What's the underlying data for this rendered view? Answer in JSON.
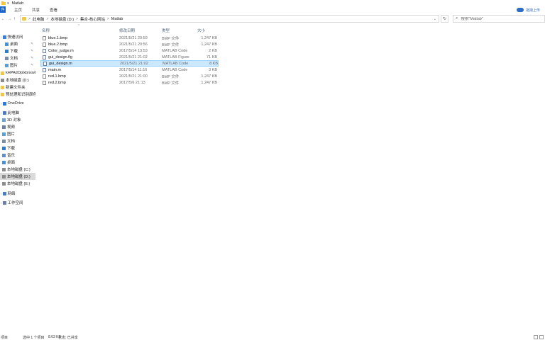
{
  "window": {
    "title": "Matlab",
    "qa_label": "▾"
  },
  "ribbon": {
    "file_tab": "件",
    "tabs": [
      "主页",
      "共享",
      "查看"
    ],
    "upload_label": "拖拽上传"
  },
  "address": {
    "crumbs": [
      "此电脑",
      "本地磁盘 (D:)",
      "集合-核心网站",
      "Matlab"
    ],
    "separator": ">"
  },
  "search": {
    "placeholder": "搜索\"Matlab\""
  },
  "nav": {
    "items": [
      {
        "label": "快速访问",
        "icon": "star-icon",
        "pin": false,
        "expand": "›",
        "selected": false
      },
      {
        "label": "桌面",
        "icon": "desktop-icon",
        "pin": true,
        "selected": false
      },
      {
        "label": "下载",
        "icon": "download-icon",
        "pin": true,
        "selected": false
      },
      {
        "label": "文档",
        "icon": "document-icon",
        "pin": true,
        "selected": false
      },
      {
        "label": "图片",
        "icon": "picture-icon",
        "pin": true,
        "selected": false
      },
      {
        "label": "kHPAdOplxbnxwt",
        "icon": "folder-icon",
        "pin": false,
        "selected": false
      },
      {
        "label": "本地磁盘 (D:)",
        "icon": "drive-icon",
        "pin": false,
        "selected": false
      },
      {
        "label": "新建文件夹",
        "icon": "folder-icon",
        "pin": false,
        "selected": false
      },
      {
        "label": "预处理和识别颜色",
        "icon": "folder-icon",
        "pin": false,
        "selected": false
      },
      {
        "label": "OneDrive",
        "icon": "cloud-icon",
        "pin": false,
        "expand": "›",
        "selected": false
      },
      {
        "label": "此电脑",
        "icon": "computer-icon",
        "pin": false,
        "expand": "›",
        "selected": false
      },
      {
        "label": "3D 对象",
        "icon": "cube-icon",
        "pin": false,
        "selected": false
      },
      {
        "label": "视频",
        "icon": "video-icon",
        "pin": false,
        "selected": false
      },
      {
        "label": "图片",
        "icon": "picture-icon",
        "pin": false,
        "selected": false
      },
      {
        "label": "文档",
        "icon": "document-icon",
        "pin": false,
        "selected": false
      },
      {
        "label": "下载",
        "icon": "download-icon",
        "pin": false,
        "selected": false
      },
      {
        "label": "音乐",
        "icon": "music-icon",
        "pin": false,
        "selected": false
      },
      {
        "label": "桌面",
        "icon": "desktop-icon",
        "pin": false,
        "selected": false
      },
      {
        "label": "本地磁盘 (C:)",
        "icon": "drive-icon",
        "pin": false,
        "selected": false
      },
      {
        "label": "本地磁盘 (D:)",
        "icon": "drive-icon",
        "pin": false,
        "selected": true
      },
      {
        "label": "本地磁盘 (E:)",
        "icon": "drive-icon",
        "pin": false,
        "selected": false
      },
      {
        "label": "网络",
        "icon": "network-icon",
        "pin": false,
        "expand": "›",
        "selected": false
      },
      {
        "label": "工作空间",
        "icon": "workspace-icon",
        "pin": false,
        "expand": "›",
        "selected": false
      }
    ]
  },
  "columns": {
    "name": "名称",
    "date": "修改日期",
    "type": "类型",
    "size": "大小"
  },
  "files": [
    {
      "name": "blue.1.bmp",
      "date": "2021/5/21 20:59",
      "type": "BMP 文件",
      "size": "1,247 KB",
      "icon": "bmp-file-icon",
      "selected": false
    },
    {
      "name": "blue.2.bmp",
      "date": "2021/5/21 20:56",
      "type": "BMP 文件",
      "size": "1,247 KB",
      "icon": "bmp-file-icon",
      "selected": false
    },
    {
      "name": "Color_judge.m",
      "date": "2017/5/14 13:53",
      "type": "MATLAB Code",
      "size": "2 KB",
      "icon": "matlab-code-icon",
      "selected": false
    },
    {
      "name": "gui_design.fig",
      "date": "2021/5/21 21:02",
      "type": "MATLAB Figure",
      "size": "71 KB",
      "icon": "matlab-figure-icon",
      "selected": false
    },
    {
      "name": "gui_design.m",
      "date": "2021/5/21 21:02",
      "type": "MATLAB Code",
      "size": "8 KB",
      "icon": "matlab-code-icon",
      "selected": true
    },
    {
      "name": "main.m",
      "date": "2017/5/14 11:16",
      "type": "MATLAB Code",
      "size": "3 KB",
      "icon": "matlab-code-icon",
      "selected": false
    },
    {
      "name": "red.1.bmp",
      "date": "2021/5/21 21:00",
      "type": "BMP 文件",
      "size": "1,247 KB",
      "icon": "bmp-file-icon",
      "selected": false
    },
    {
      "name": "red.2.bmp",
      "date": "2017/5/6 21:13",
      "type": "BMP 文件",
      "size": "1,247 KB",
      "icon": "bmp-file-icon",
      "selected": false
    }
  ],
  "status": {
    "items_count": "项目",
    "selected": "选中 1 个项目",
    "selected_size": "8.63 KB",
    "share_state": "状态: 已共享"
  },
  "colors": {
    "accent": "#1a63c7",
    "selection": "#cce8ff",
    "selection_border": "#99d1ff",
    "folder": "#f3c743"
  }
}
